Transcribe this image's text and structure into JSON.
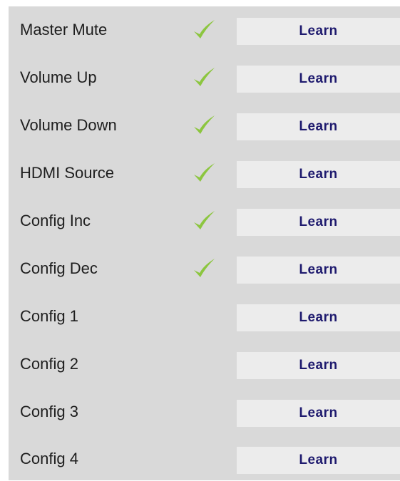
{
  "rows": [
    {
      "label": "Master Mute",
      "learned": true,
      "button_label": "Learn"
    },
    {
      "label": "Volume Up",
      "learned": true,
      "button_label": "Learn"
    },
    {
      "label": "Volume Down",
      "learned": true,
      "button_label": "Learn"
    },
    {
      "label": "HDMI Source",
      "learned": true,
      "button_label": "Learn"
    },
    {
      "label": "Config Inc",
      "learned": true,
      "button_label": "Learn"
    },
    {
      "label": "Config Dec",
      "learned": true,
      "button_label": "Learn"
    },
    {
      "label": "Config 1",
      "learned": false,
      "button_label": "Learn"
    },
    {
      "label": "Config 2",
      "learned": false,
      "button_label": "Learn"
    },
    {
      "label": "Config 3",
      "learned": false,
      "button_label": "Learn"
    },
    {
      "label": "Config 4",
      "learned": false,
      "button_label": "Learn"
    }
  ],
  "colors": {
    "panel_background": "#d9d9d9",
    "button_background": "#ececec",
    "button_text": "#1e1a6e",
    "checkmark": "#8cc63f"
  },
  "icons": {
    "learned_indicator": "checkmark-icon"
  }
}
